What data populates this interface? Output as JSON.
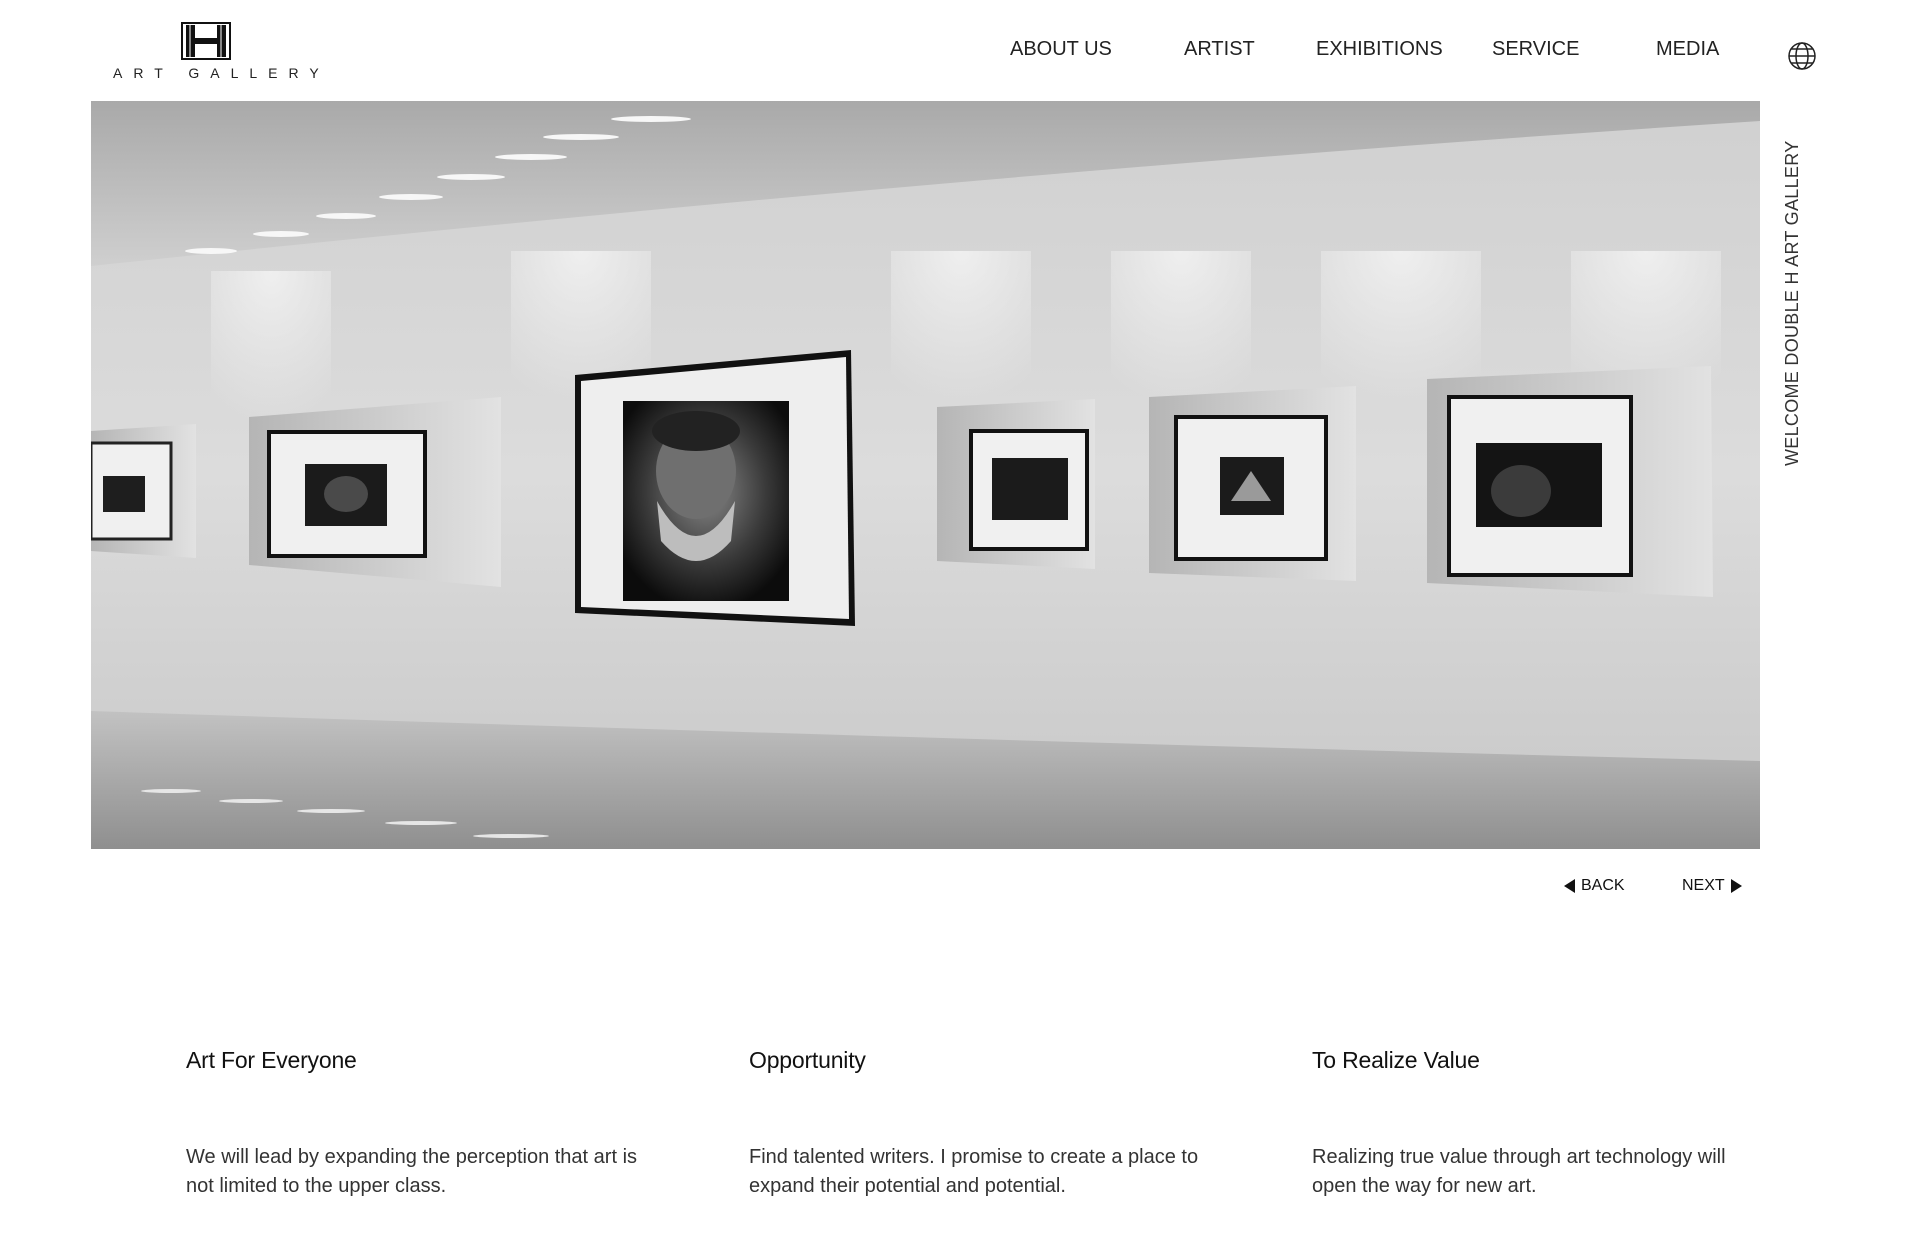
{
  "logo": {
    "text": "ART GALLERY",
    "mark": "double-h-mark"
  },
  "nav": {
    "items": [
      {
        "label": "ABOUT US"
      },
      {
        "label": "ARTIST"
      },
      {
        "label": "EXHIBITIONS"
      },
      {
        "label": "SERVICE"
      },
      {
        "label": "MEDIA"
      }
    ],
    "language_icon": "globe-icon"
  },
  "hero": {
    "image": "gallery-hallway-with-framed-photographs",
    "side_text": "WELCOME DOUBLE H ART GALLERY"
  },
  "pager": {
    "back_label": "BACK",
    "next_label": "NEXT"
  },
  "features": [
    {
      "title": "Art For Everyone",
      "body": "We will lead by expanding the perception that art is not limited to the upper class."
    },
    {
      "title": "Opportunity",
      "body": "Find talented writers. I promise to create a place to expand their potential and potential."
    },
    {
      "title": "To Realize Value",
      "body": "Realizing true value through art technology will open the way for new art."
    }
  ],
  "colors": {
    "text": "#1a1a1a",
    "wall": "#d6d6d6",
    "frame": "#111111",
    "background": "#ffffff"
  }
}
